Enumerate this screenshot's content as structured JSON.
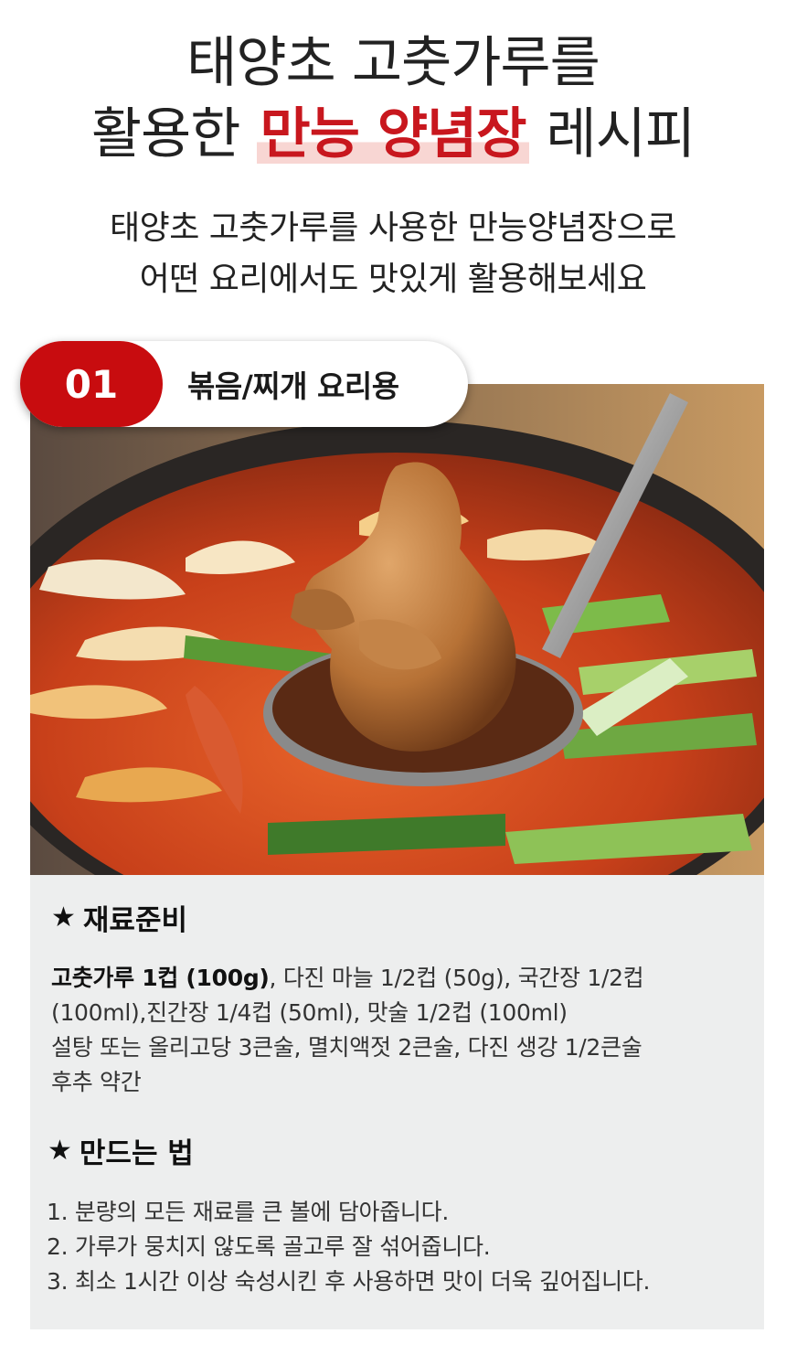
{
  "title": {
    "line1": "태양초 고춧가루를",
    "line2_prefix": "활용한",
    "line2_highlight": "만능 양념장",
    "line2_suffix": "레시피"
  },
  "subtitle": {
    "line1": "태양초 고춧가루를 사용한 만능양념장으로",
    "line2": "어떤 요리에서도 맛있게 활용해보세요"
  },
  "badge": {
    "number": "01",
    "label": "볶음/찌개 요리용"
  },
  "ingredients": {
    "heading_star": "★",
    "heading": "재료준비",
    "line1_bold": "고춧가루 1컵 (100g)",
    "line1_rest": ", 다진 마늘 1/2컵 (50g), 국간장 1/2컵",
    "line2": "(100ml),진간장 1/4컵 (50ml), 맛술 1/2컵 (100ml)",
    "line3": "설탕 또는 올리고당 3큰술, 멸치액젓 2큰술, 다진 생강 1/2큰술",
    "line4": "후추 약간"
  },
  "method": {
    "heading_star": "★",
    "heading": "만드는 법",
    "steps": [
      "1. 분량의 모든 재료를 큰 볼에 담아줍니다.",
      "2. 가루가 뭉치지 않도록 골고루 잘 섞어줍니다.",
      "3. 최소 1시간 이상 숙성시킨 후 사용하면 맛이 더욱 깊어집니다."
    ]
  },
  "colors": {
    "accent": "#c80c0f",
    "highlight_bg": "#f8d6d3",
    "panel_bg": "#edeeee"
  },
  "icons": {
    "star": "star-icon"
  }
}
